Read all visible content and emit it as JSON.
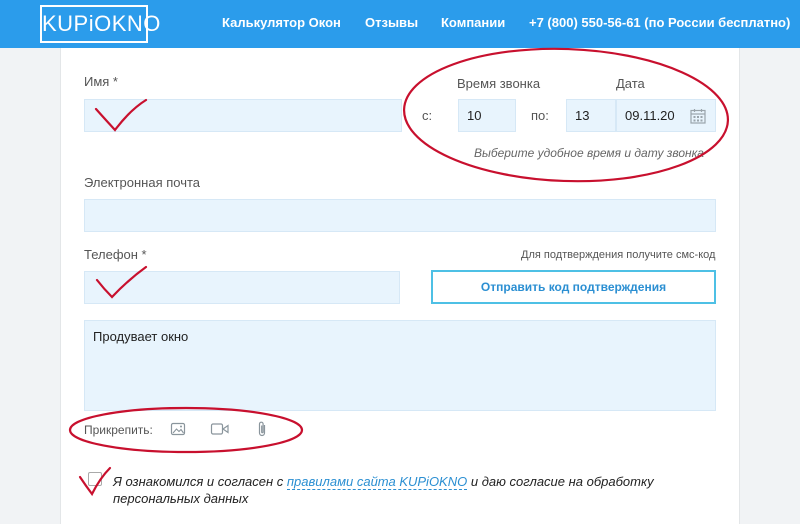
{
  "header": {
    "logo": "KUPiOKNO",
    "nav": [
      "Калькулятор Окон",
      "Отзывы",
      "Компании",
      "+7 (800) 550-56-61 (по России бесплатно)"
    ]
  },
  "form": {
    "name_label": "Имя *",
    "call_time_label": "Время звонка",
    "date_label": "Дата",
    "from_label": "с:",
    "to_label": "по:",
    "from_value": "10",
    "to_value": "13",
    "date_value": "09.11.20",
    "call_hint": "Выберите удобное время и дату звонка",
    "email_label": "Электронная почта",
    "phone_label": "Телефон *",
    "sms_hint": "Для подтверждения получите смс-код",
    "send_code_button": "Отправить код подтверждения",
    "message_value": "Продувает окно",
    "attach_label": "Прикрепить:",
    "consent_prefix": "Я ознакомился и согласен с ",
    "consent_link": "правилами сайта KUPiOKNO",
    "consent_suffix": " и даю согласие на обработку персональных данных"
  },
  "icons": [
    "image-icon",
    "video-icon",
    "paperclip-icon",
    "calendar-icon"
  ],
  "colors": {
    "header": "#2b9ceb",
    "field": "#e8f4fd",
    "annotation": "#c8102e"
  }
}
